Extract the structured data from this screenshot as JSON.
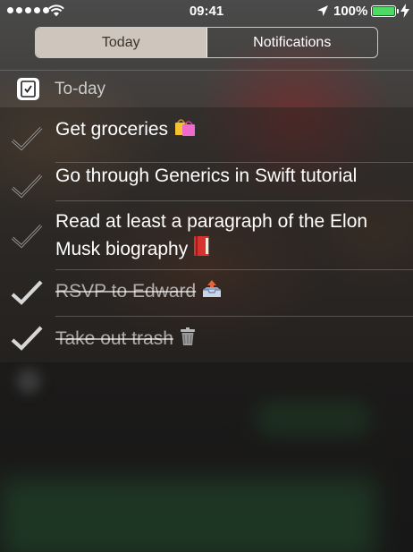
{
  "status_bar": {
    "time": "09:41",
    "battery_percent": "100%",
    "battery_level": 1.0,
    "signal_bars": 5
  },
  "segmented_control": {
    "tabs": [
      {
        "label": "Today",
        "selected": true
      },
      {
        "label": "Notifications",
        "selected": false
      }
    ]
  },
  "widget": {
    "title": "To-day",
    "app_icon": "checkmark-square-icon",
    "tasks": [
      {
        "text": "Get groceries",
        "emoji": "shopping-bags-icon",
        "done": false
      },
      {
        "text": "Go through Generics in Swift tutorial",
        "emoji": "",
        "done": false
      },
      {
        "text": "Read at least a paragraph of the Elon Musk biography",
        "emoji": "red-book-icon",
        "done": false
      },
      {
        "text": "RSVP to Edward",
        "emoji": "outbox-tray-icon",
        "done": true
      },
      {
        "text": "Take out trash",
        "emoji": "trash-can-icon",
        "done": true
      }
    ]
  },
  "colors": {
    "battery_green": "#4cd964",
    "segment_selected_bg": "#e1d7cd",
    "segment_selected_text": "#3a3430"
  }
}
